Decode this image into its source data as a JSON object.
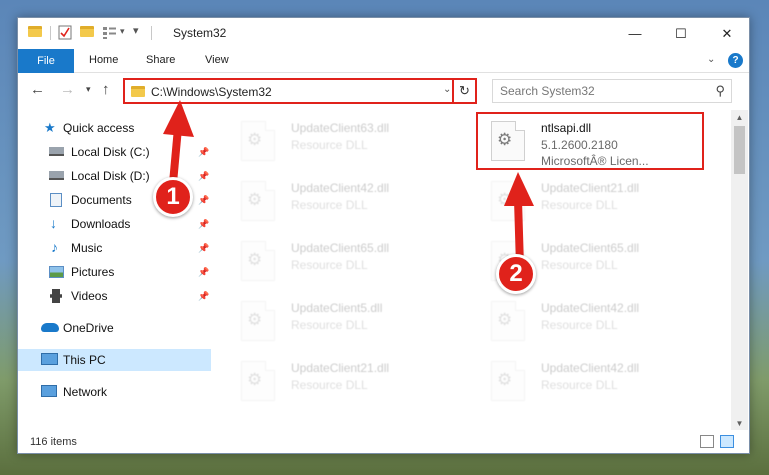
{
  "window": {
    "title": "System32",
    "controls": {
      "minimize": "—",
      "maximize": "☐",
      "close": "✕"
    }
  },
  "ribbon": {
    "file": "File",
    "tabs": [
      "Home",
      "Share",
      "View"
    ],
    "help": "?"
  },
  "address_bar": {
    "path": "C:\\Windows\\System32",
    "search_placeholder": "Search System32"
  },
  "sidebar": {
    "items": [
      {
        "label": "Quick access",
        "icon": "star-icon"
      },
      {
        "label": "Local Disk (C:)",
        "icon": "drive-icon",
        "pinned": true
      },
      {
        "label": "Local Disk (D:)",
        "icon": "drive-icon",
        "pinned": true
      },
      {
        "label": "Documents",
        "icon": "documents-icon",
        "pinned": true
      },
      {
        "label": "Downloads",
        "icon": "downloads-icon",
        "pinned": true
      },
      {
        "label": "Music",
        "icon": "music-icon",
        "pinned": true
      },
      {
        "label": "Pictures",
        "icon": "pictures-icon",
        "pinned": true
      },
      {
        "label": "Videos",
        "icon": "videos-icon",
        "pinned": true
      },
      {
        "label": "OneDrive",
        "icon": "cloud-icon"
      },
      {
        "label": "This PC",
        "icon": "computer-icon",
        "selected": true
      },
      {
        "label": "Network",
        "icon": "network-icon"
      }
    ]
  },
  "files": [
    {
      "name": "UpdateClient63.dll",
      "type": "Resource DLL"
    },
    {
      "name": "ntlsapi.dll",
      "version": "5.1.2600.2180",
      "company": "MicrosoftÂ® Licen...",
      "highlighted": true
    },
    {
      "name": "UpdateClient42.dll",
      "type": "Resource DLL"
    },
    {
      "name": "UpdateClient21.dll",
      "type": "Resource DLL"
    },
    {
      "name": "UpdateClient65.dll",
      "type": "Resource DLL"
    },
    {
      "name": "UpdateClient65.dll",
      "type": "Resource DLL"
    },
    {
      "name": "UpdateClient5.dll",
      "type": "Resource DLL"
    },
    {
      "name": "UpdateClient42.dll",
      "type": "Resource DLL"
    },
    {
      "name": "UpdateClient21.dll",
      "type": "Resource DLL"
    },
    {
      "name": "UpdateClient42.dll",
      "type": "Resource DLL"
    }
  ],
  "status": {
    "item_count": "116 items"
  },
  "callouts": {
    "step1": "1",
    "step2": "2"
  },
  "colors": {
    "accent": "#1979ca",
    "callout": "#e0221b",
    "selected": "#cce8ff"
  }
}
